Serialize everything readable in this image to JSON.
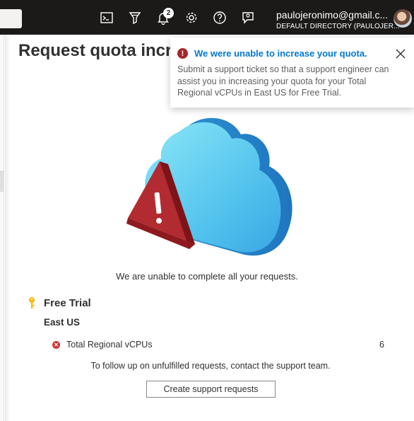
{
  "topbar": {
    "icons": [
      "cloud-shell-icon",
      "directory-filter-icon",
      "notifications-icon",
      "settings-icon",
      "help-icon",
      "feedback-icon"
    ],
    "notification_count": "2",
    "account_email": "paulojeronimo@gmail.c...",
    "account_directory": "DEFAULT DIRECTORY (PAULOJER..."
  },
  "page": {
    "title": "Request quota incre"
  },
  "toast": {
    "title": "We were unable to increase your quota.",
    "body": "Submit a support ticket so that a support engineer can assist you in increasing your quota for your Total Regional vCPUs in East US for Free Trial.",
    "error_glyph": "!",
    "title_color": "#0078d4"
  },
  "content": {
    "message": "We are unable to complete all your requests.",
    "subscription": "Free Trial",
    "region": "East US",
    "quota_name": "Total Regional vCPUs",
    "quota_value": "6",
    "follow_up": "To follow up on unfulfilled requests, contact the support team.",
    "button_label": "Create support requests"
  },
  "colors": {
    "topbar": "#1b1a19",
    "error": "#a4262c",
    "key": "#ffb900"
  }
}
